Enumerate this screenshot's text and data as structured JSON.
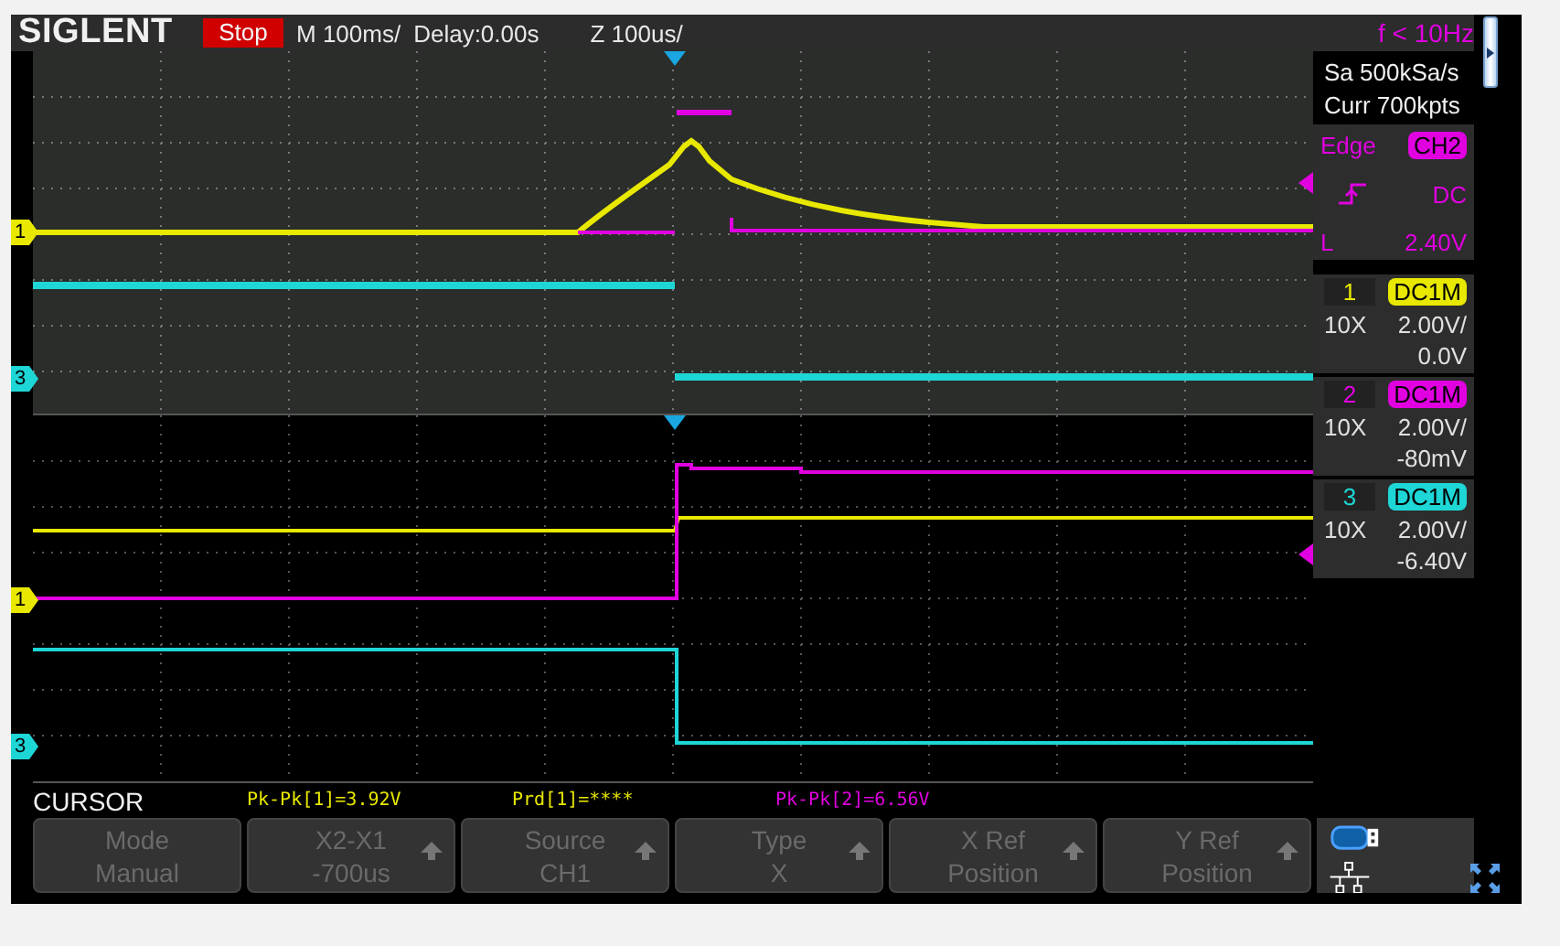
{
  "top_bar": {
    "brand": "SIGLENT",
    "run_state": "Stop",
    "timebase": "M 100ms/",
    "delay": "Delay:0.00s",
    "zoom": "Z 100us/",
    "trigger_frequency": "f < 10Hz"
  },
  "acquisition": {
    "sample_rate": "Sa 500kSa/s",
    "memory": "Curr 700kpts"
  },
  "trigger": {
    "type": "Edge",
    "source": "CH2",
    "coupling": "DC",
    "level_label": "L",
    "level_value": "2.40V",
    "color": "#e000e0"
  },
  "channels": [
    {
      "number": "1",
      "coupling": "DC1M",
      "probe": "10X",
      "scale": "2.00V/",
      "offset": "0.0V",
      "color": "#e8e800"
    },
    {
      "number": "2",
      "coupling": "DC1M",
      "probe": "10X",
      "scale": "2.00V/",
      "offset": "-80mV",
      "color": "#e000e0"
    },
    {
      "number": "3",
      "coupling": "DC1M",
      "probe": "10X",
      "scale": "2.00V/",
      "offset": "-6.40V",
      "color": "#1ed6d6"
    }
  ],
  "plot_markers": [
    {
      "label": "1",
      "color": "#e8e800"
    },
    {
      "label": "3",
      "color": "#1ed6d6"
    },
    {
      "label": "1",
      "color": "#e8e800"
    },
    {
      "label": "3",
      "color": "#1ed6d6"
    }
  ],
  "cursor": {
    "title": "CURSOR",
    "measurements": [
      {
        "text": "Pk-Pk[1]=3.92V",
        "color": "#e8e800"
      },
      {
        "text": "Prd[1]=****",
        "color": "#e8e800"
      },
      {
        "text": "Pk-Pk[2]=6.56V",
        "color": "#e000e0"
      }
    ]
  },
  "softkeys": [
    {
      "title": "Mode",
      "value": "Manual",
      "adjustable": false
    },
    {
      "title": "X2-X1",
      "value": "-700us",
      "adjustable": true
    },
    {
      "title": "Source",
      "value": "CH1",
      "adjustable": true
    },
    {
      "title": "Type",
      "value": "X",
      "adjustable": true
    },
    {
      "title": "X Ref",
      "value": "Position",
      "adjustable": true
    },
    {
      "title": "Y Ref",
      "value": "Position",
      "adjustable": true
    }
  ]
}
